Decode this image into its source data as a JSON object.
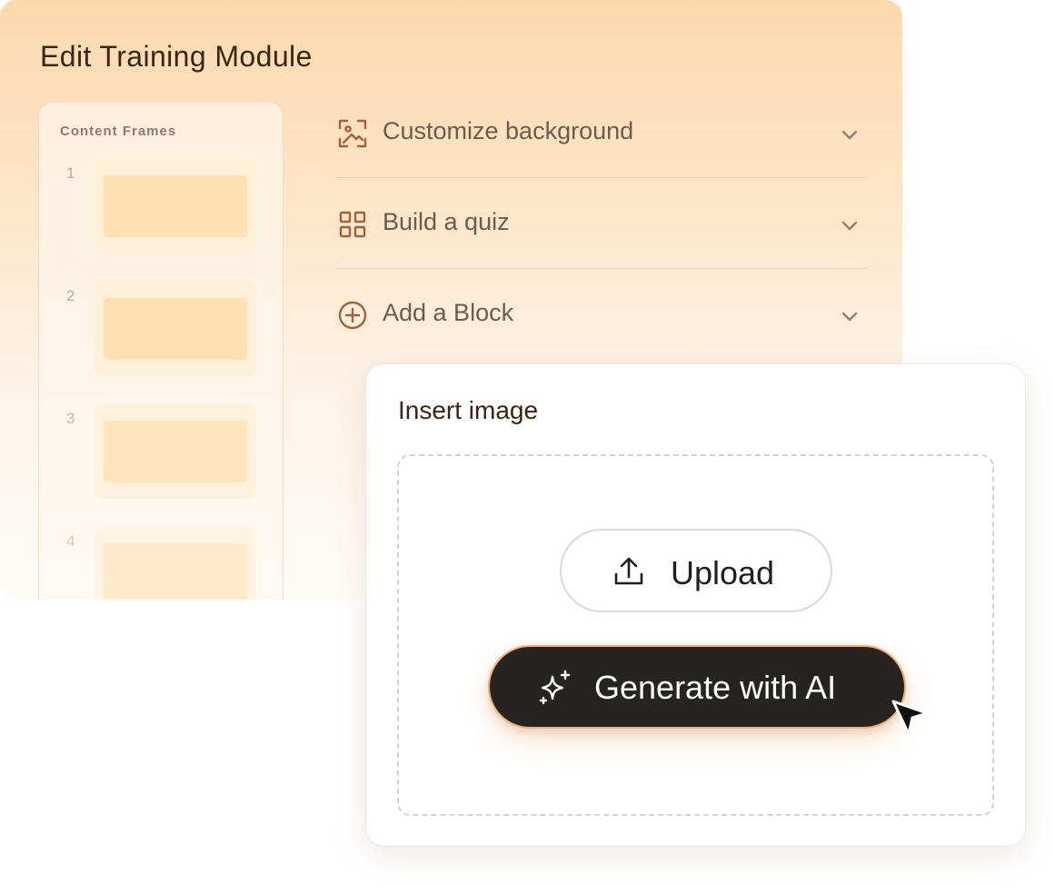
{
  "editor": {
    "title": "Edit Training Module",
    "frames_panel": {
      "label": "Content Frames",
      "frames": [
        {
          "number": "1"
        },
        {
          "number": "2"
        },
        {
          "number": "3"
        },
        {
          "number": "4"
        }
      ]
    },
    "accordion": [
      {
        "label": "Customize background",
        "icon": "image-frame-icon"
      },
      {
        "label": "Build a quiz",
        "icon": "grid-icon"
      },
      {
        "label": "Add a Block",
        "icon": "plus-circle-icon"
      }
    ]
  },
  "insert_image": {
    "title": "Insert image",
    "upload_label": "Upload",
    "upload_icon": "upload-icon",
    "generate_label": "Generate with AI",
    "generate_icon": "sparkle-icon"
  },
  "colors": {
    "accent": "#f2b170",
    "icon_brown": "#a1613a",
    "button_dark": "#262321"
  }
}
